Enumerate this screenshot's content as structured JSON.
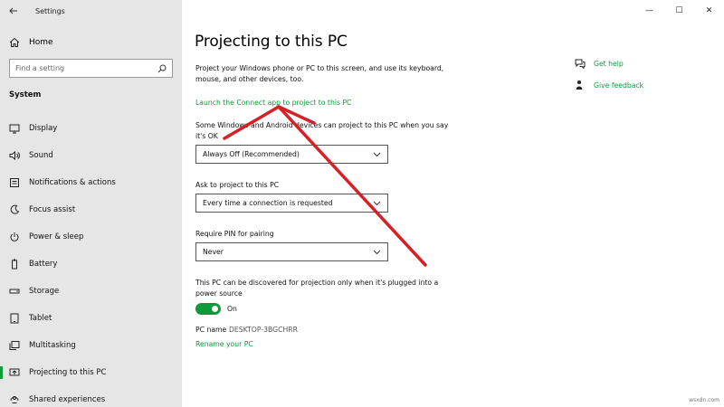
{
  "window": {
    "title": "Settings",
    "controls": {
      "minimize": "—",
      "maximize": "☐",
      "close": "✕"
    }
  },
  "sidebar": {
    "home_label": "Home",
    "search_placeholder": "Find a setting",
    "section_heading": "System",
    "items": [
      {
        "label": "Display",
        "icon": "display-icon"
      },
      {
        "label": "Sound",
        "icon": "sound-icon"
      },
      {
        "label": "Notifications & actions",
        "icon": "notifications-icon"
      },
      {
        "label": "Focus assist",
        "icon": "focus-assist-icon"
      },
      {
        "label": "Power & sleep",
        "icon": "power-icon"
      },
      {
        "label": "Battery",
        "icon": "battery-icon"
      },
      {
        "label": "Storage",
        "icon": "storage-icon"
      },
      {
        "label": "Tablet",
        "icon": "tablet-icon"
      },
      {
        "label": "Multitasking",
        "icon": "multitasking-icon"
      },
      {
        "label": "Projecting to this PC",
        "icon": "projecting-icon",
        "active": true
      },
      {
        "label": "Shared experiences",
        "icon": "shared-experiences-icon"
      }
    ]
  },
  "main": {
    "title": "Projecting to this PC",
    "description": "Project your Windows phone or PC to this screen, and use its keyboard, mouse, and other devices, too.",
    "connect_link": "Launch the Connect app to project to this PC",
    "availability_label": "Some Windows and Android devices can project to this PC when you say it's OK",
    "availability_value": "Always Off (Recommended)",
    "ask_label": "Ask to project to this PC",
    "ask_value": "Every time a connection is requested",
    "pin_label": "Require PIN for pairing",
    "pin_value": "Never",
    "power_label": "This PC can be discovered for projection only when it's plugged into a power source",
    "power_toggle_state": "On",
    "power_toggle_on": true,
    "pc_name_label": "PC name",
    "pc_name_value": "DESKTOP-3BGCHRR",
    "rename_link": "Rename your PC",
    "help": {
      "get_help": "Get help",
      "give_feedback": "Give feedback"
    }
  },
  "watermark": "wsxdn.com",
  "colors": {
    "accent": "#0c9a3c",
    "sidebar_bg": "#e6e6e6",
    "annotation_arrow": "#d62026"
  }
}
